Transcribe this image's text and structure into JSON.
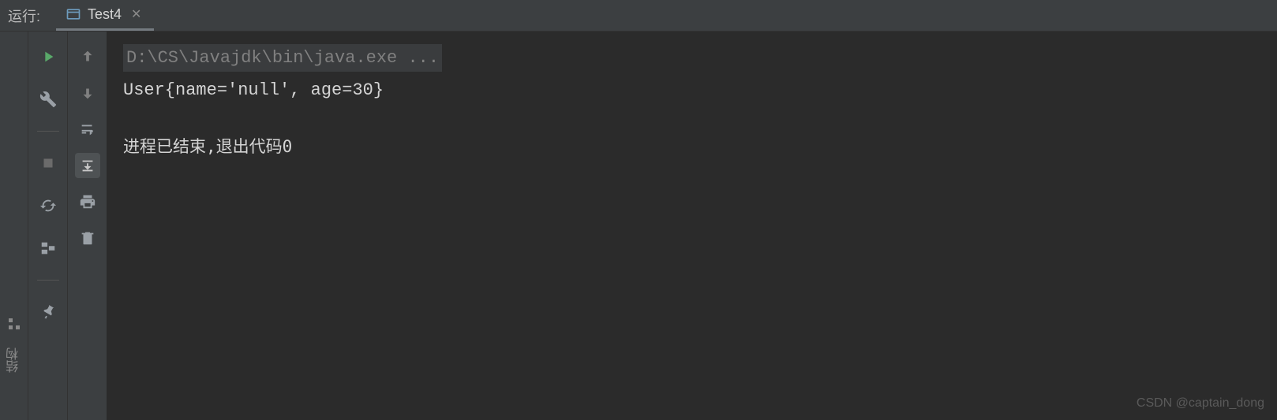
{
  "header": {
    "run_label": "运行:",
    "tab_title": "Test4"
  },
  "console": {
    "command": "D:\\CS\\Javajdk\\bin\\java.exe ...",
    "output": "User{name='null', age=30}",
    "exit_message": "进程已结束,退出代码0"
  },
  "sidebar": {
    "structure_label": "结构"
  },
  "watermark": "CSDN @captain_dong"
}
